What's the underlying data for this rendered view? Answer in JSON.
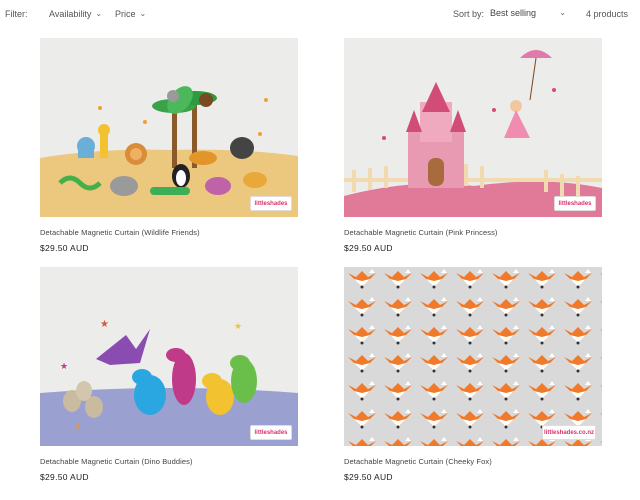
{
  "filter": {
    "label": "Filter:",
    "availability": "Availability",
    "price": "Price",
    "sort_label": "Sort by:",
    "sort_value": "Best selling",
    "count": "4 products"
  },
  "products": [
    {
      "title": "Detachable Magnetic Curtain (Wildlife Friends)",
      "price": "$29.50 AUD",
      "logo": "littleshades"
    },
    {
      "title": "Detachable Magnetic Curtain (Pink Princess)",
      "price": "$29.50 AUD",
      "logo": "littleshades"
    },
    {
      "title": "Detachable Magnetic Curtain (Dino Buddies)",
      "price": "$29.50 AUD",
      "logo": "littleshades"
    },
    {
      "title": "Detachable Magnetic Curtain (Cheeky Fox)",
      "price": "$29.50 AUD",
      "logo": "littleshades.co.nz"
    }
  ],
  "colors": {
    "background": "#ffffff",
    "image_bg": "#ececeb",
    "brand_pink": "#d6336c"
  }
}
